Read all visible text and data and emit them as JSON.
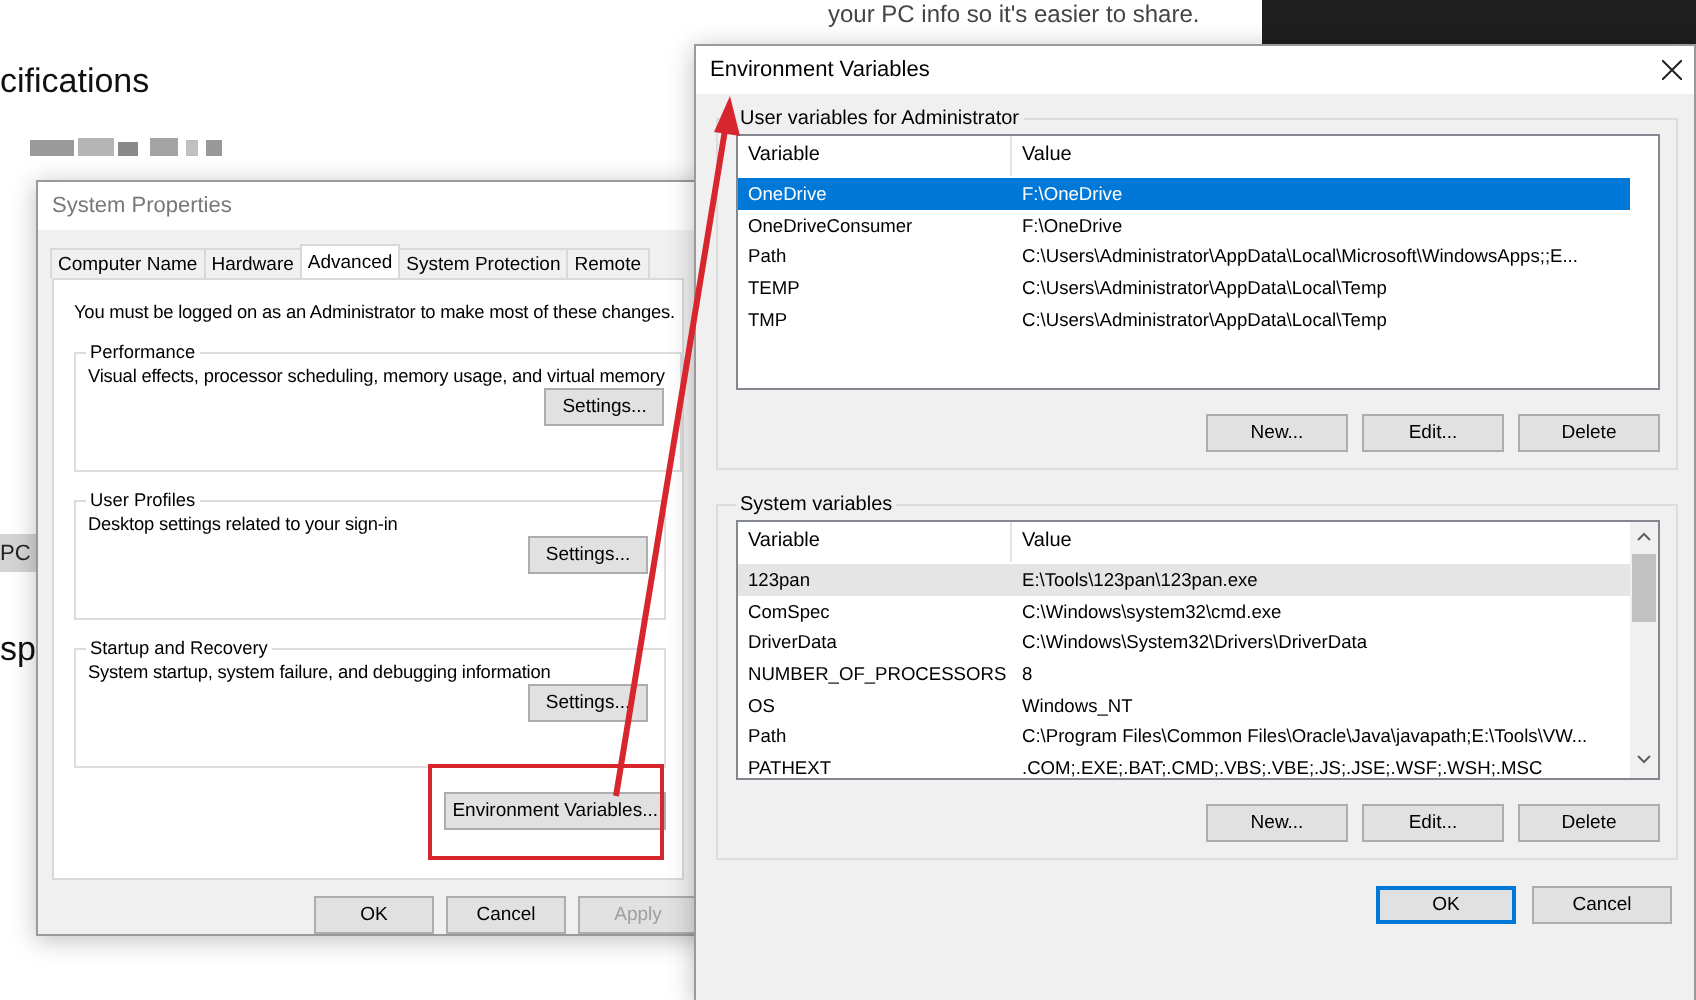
{
  "background_page": {
    "top_text": "your PC info so it's easier to share.",
    "heading": "cifications",
    "button": "PC",
    "heading_2": "sp"
  },
  "system_properties": {
    "title": "System Properties",
    "tabs": [
      {
        "label": "Computer Name",
        "selected": false
      },
      {
        "label": "Hardware",
        "selected": false
      },
      {
        "label": "Advanced",
        "selected": true
      },
      {
        "label": "System Protection",
        "selected": false
      },
      {
        "label": "Remote",
        "selected": false
      }
    ],
    "notice": "You must be logged on as an Administrator to make most of these changes.",
    "groups": [
      {
        "title": "Performance",
        "description": "Visual effects, processor scheduling, memory usage, and virtual memory",
        "button": "Settings..."
      },
      {
        "title": "User Profiles",
        "description": "Desktop settings related to your sign-in",
        "button": "Settings..."
      },
      {
        "title": "Startup and Recovery",
        "description": "System startup, system failure, and debugging information",
        "button": "Settings..."
      }
    ],
    "env_button": "Environment Variables...",
    "buttons": [
      {
        "label": "OK",
        "disabled": false
      },
      {
        "label": "Cancel",
        "disabled": false
      },
      {
        "label": "Apply",
        "disabled": true
      }
    ]
  },
  "environment_variables": {
    "title": "Environment Variables",
    "sections": [
      {
        "title": "User variables for Administrator",
        "focused": true,
        "scrollable": false,
        "columns": [
          "Variable",
          "Value"
        ],
        "rows": [
          {
            "variable": "OneDrive",
            "value": "F:\\OneDrive",
            "selected": true
          },
          {
            "variable": "OneDriveConsumer",
            "value": "F:\\OneDrive",
            "selected": false
          },
          {
            "variable": "Path",
            "value": "C:\\Users\\Administrator\\AppData\\Local\\Microsoft\\WindowsApps;;E...",
            "selected": false
          },
          {
            "variable": "TEMP",
            "value": "C:\\Users\\Administrator\\AppData\\Local\\Temp",
            "selected": false
          },
          {
            "variable": "TMP",
            "value": "C:\\Users\\Administrator\\AppData\\Local\\Temp",
            "selected": false
          }
        ],
        "buttons": [
          "New...",
          "Edit...",
          "Delete"
        ]
      },
      {
        "title": "System variables",
        "focused": false,
        "scrollable": true,
        "columns": [
          "Variable",
          "Value"
        ],
        "rows": [
          {
            "variable": "123pan",
            "value": "E:\\Tools\\123pan\\123pan.exe",
            "selected": true
          },
          {
            "variable": "ComSpec",
            "value": "C:\\Windows\\system32\\cmd.exe",
            "selected": false
          },
          {
            "variable": "DriverData",
            "value": "C:\\Windows\\System32\\Drivers\\DriverData",
            "selected": false
          },
          {
            "variable": "NUMBER_OF_PROCESSORS",
            "value": "8",
            "selected": false
          },
          {
            "variable": "OS",
            "value": "Windows_NT",
            "selected": false
          },
          {
            "variable": "Path",
            "value": "C:\\Program Files\\Common Files\\Oracle\\Java\\javapath;E:\\Tools\\VW...",
            "selected": false
          },
          {
            "variable": "PATHEXT",
            "value": ".COM;.EXE;.BAT;.CMD;.VBS;.VBE;.JS;.JSE;.WSF;.WSH;.MSC",
            "selected": false
          }
        ],
        "buttons": [
          "New...",
          "Edit...",
          "Delete"
        ]
      }
    ],
    "buttons": [
      {
        "label": "OK",
        "default": true
      },
      {
        "label": "Cancel",
        "default": false
      }
    ]
  }
}
